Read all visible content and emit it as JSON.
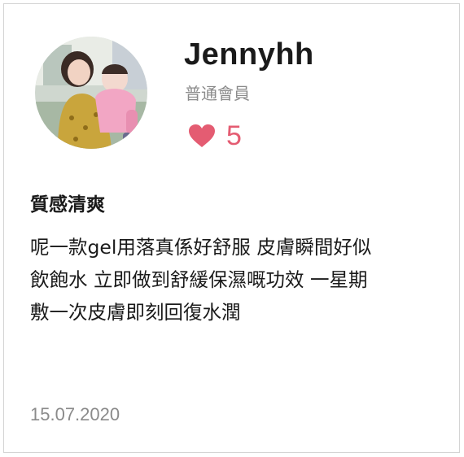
{
  "user": {
    "name": "Jennyhh",
    "level": "普通會員",
    "avatar_icon": "user-photo-avatar"
  },
  "likes": {
    "icon": "heart-icon",
    "count": "5",
    "color": "#e45c72"
  },
  "review": {
    "title": "質感清爽",
    "body": "呢一款gel用落真係好舒服 皮膚瞬間好似\n飲飽水 立即做到舒緩保濕嘅功效 一星期\n敷一次皮膚即刻回復水潤",
    "date": "15.07.2020"
  }
}
